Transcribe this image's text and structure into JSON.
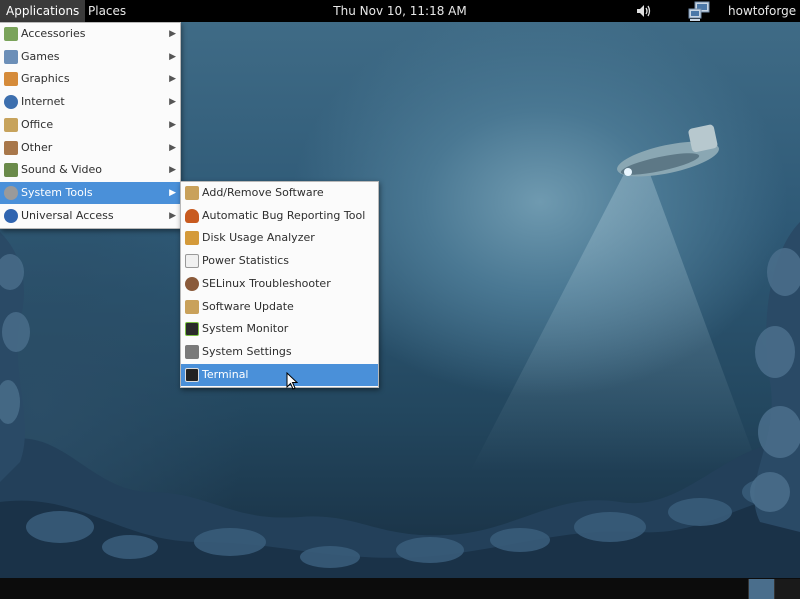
{
  "top_panel": {
    "applications_label": "Applications",
    "places_label": "Places",
    "clock": "Thu Nov 10, 11:18 AM",
    "user": "howtoforge"
  },
  "menu": {
    "categories": [
      {
        "label": "Accessories",
        "icon": "accessories-icon",
        "color": "#7aa35a"
      },
      {
        "label": "Games",
        "icon": "games-icon",
        "color": "#6c8fb8"
      },
      {
        "label": "Graphics",
        "icon": "graphics-icon",
        "color": "#d58b3a"
      },
      {
        "label": "Internet",
        "icon": "internet-icon",
        "color": "#3d6fae"
      },
      {
        "label": "Office",
        "icon": "office-icon",
        "color": "#c7a35c"
      },
      {
        "label": "Other",
        "icon": "other-icon",
        "color": "#a8774a"
      },
      {
        "label": "Sound & Video",
        "icon": "sound-video-icon",
        "color": "#6a8a4a"
      },
      {
        "label": "System Tools",
        "icon": "system-tools-icon",
        "color": "#9a9a9a"
      },
      {
        "label": "Universal Access",
        "icon": "universal-access-icon",
        "color": "#2f64b0"
      }
    ],
    "selected_category": "System Tools",
    "system_tools": [
      {
        "label": "Add/Remove Software",
        "icon": "package-icon",
        "color": "#c9a15a"
      },
      {
        "label": "Automatic Bug Reporting Tool",
        "icon": "bug-icon",
        "color": "#c85a1f"
      },
      {
        "label": "Disk Usage Analyzer",
        "icon": "disk-usage-icon",
        "color": "#d49a3a"
      },
      {
        "label": "Power Statistics",
        "icon": "power-statistics-icon",
        "color": "#c24b4b"
      },
      {
        "label": "SELinux Troubleshooter",
        "icon": "selinux-icon",
        "color": "#8a5a3a"
      },
      {
        "label": "Software Update",
        "icon": "software-update-icon",
        "color": "#c9a15a"
      },
      {
        "label": "System Monitor",
        "icon": "system-monitor-icon",
        "color": "#2a2a2a"
      },
      {
        "label": "System Settings",
        "icon": "settings-icon",
        "color": "#7a7a7a"
      },
      {
        "label": "Terminal",
        "icon": "terminal-icon",
        "color": "#222222"
      }
    ],
    "selected_item": "Terminal"
  },
  "colors": {
    "selection": "#4a90d9",
    "panel": "#000000",
    "menu_bg": "#fbfbfb"
  }
}
